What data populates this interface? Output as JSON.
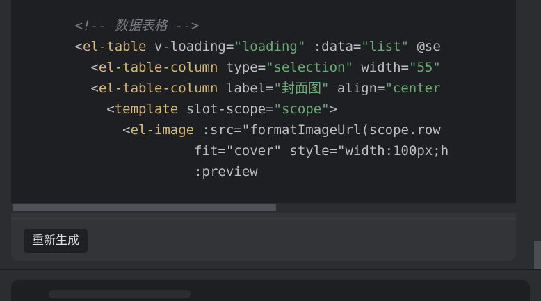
{
  "code": {
    "lines": [
      [
        {
          "t": "        "
        },
        {
          "t": "<!-- 数据表格 -->",
          "c": "comment"
        }
      ],
      [
        {
          "t": "        "
        },
        {
          "t": "<",
          "c": "punct"
        },
        {
          "t": "el-table",
          "c": "tag"
        },
        {
          "t": " v-loading=",
          "c": "attr"
        },
        {
          "t": "\"loading\"",
          "c": "str"
        },
        {
          "t": " :data=",
          "c": "attr"
        },
        {
          "t": "\"list\"",
          "c": "str"
        },
        {
          "t": " @se",
          "c": "attr"
        }
      ],
      [
        {
          "t": "          "
        },
        {
          "t": "<",
          "c": "punct"
        },
        {
          "t": "el-table-column",
          "c": "tag"
        },
        {
          "t": " type=",
          "c": "attr"
        },
        {
          "t": "\"selection\"",
          "c": "str"
        },
        {
          "t": " width=",
          "c": "attr"
        },
        {
          "t": "\"55\"",
          "c": "str"
        }
      ],
      [
        {
          "t": "          "
        },
        {
          "t": "<",
          "c": "punct"
        },
        {
          "t": "el-table-column",
          "c": "tag"
        },
        {
          "t": " label=",
          "c": "attr"
        },
        {
          "t": "\"封面图\"",
          "c": "str"
        },
        {
          "t": " align=",
          "c": "attr"
        },
        {
          "t": "\"center",
          "c": "str"
        }
      ],
      [
        {
          "t": "            "
        },
        {
          "t": "<",
          "c": "punct"
        },
        {
          "t": "template",
          "c": "tag"
        },
        {
          "t": " slot-scope=",
          "c": "attr"
        },
        {
          "t": "\"scope\"",
          "c": "str"
        },
        {
          "t": ">",
          "c": "punct"
        }
      ],
      [
        {
          "t": "              "
        },
        {
          "t": "<",
          "c": "punct"
        },
        {
          "t": "el-image",
          "c": "tag"
        },
        {
          "t": " :src=",
          "c": "attr"
        },
        {
          "t": "\"formatImageUrl(scope.row",
          "c": "attr"
        }
      ],
      [
        {
          "t": "                       "
        },
        {
          "t": "fit=",
          "c": "attr"
        },
        {
          "t": "\"cover\"",
          "c": "attr"
        },
        {
          "t": " style=",
          "c": "attr"
        },
        {
          "t": "\"width:100px;h",
          "c": "attr"
        }
      ],
      [
        {
          "t": "                       "
        },
        {
          "t": ":preview",
          "c": "attr"
        }
      ]
    ]
  },
  "actions": {
    "regenerate_label": "重新生成"
  },
  "colors": {
    "background": "#2b2d30",
    "code_bg": "#1e1f22",
    "tag": "#d5b778",
    "string": "#6aab73",
    "comment": "#7a7e85",
    "text": "#bcbec4"
  }
}
